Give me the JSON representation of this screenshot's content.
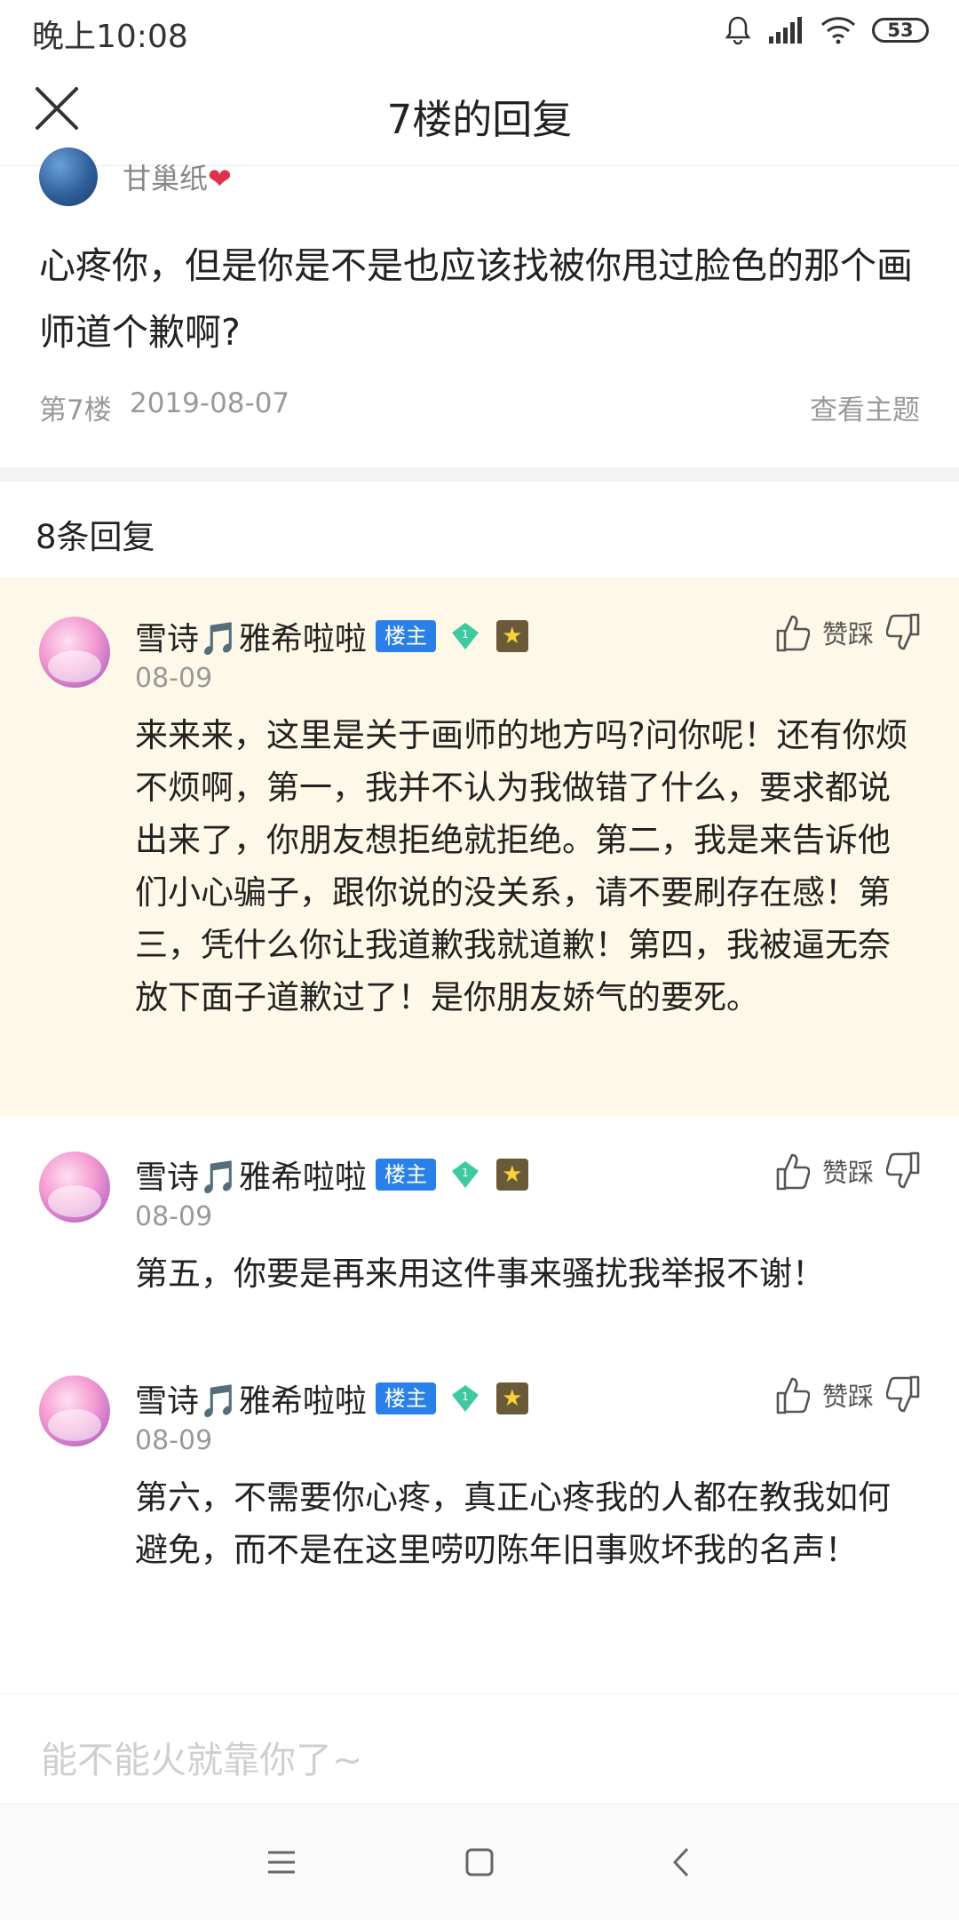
{
  "status_bar": {
    "time": "晚上10:08",
    "battery": "53"
  },
  "header": {
    "title": "7楼的回复"
  },
  "post": {
    "author": "甘巢纸",
    "body": "心疼你，但是你是不是也应该找被你甩过脸色的那个画师道个歉啊?",
    "floor": "第7楼",
    "date": "2019-08-07",
    "view_topic": "查看主题"
  },
  "reply_count_label": "8条回复",
  "replies": [
    {
      "name": "雪诗🎵雅希啦啦",
      "badge": "楼主",
      "level": "1",
      "date": "08-09",
      "like_label": "赞踩",
      "text": "来来来，这里是关于画师的地方吗?问你呢！还有你烦不烦啊，第一，我并不认为我做错了什么，要求都说出来了，你朋友想拒绝就拒绝。第二，我是来告诉他们小心骗子，跟你说的没关系，请不要刷存在感！第三，凭什么你让我道歉我就道歉！第四，我被逼无奈放下面子道歉过了！是你朋友娇气的要死。"
    },
    {
      "name": "雪诗🎵雅希啦啦",
      "badge": "楼主",
      "level": "1",
      "date": "08-09",
      "like_label": "赞踩",
      "text": "第五，你要是再来用这件事来骚扰我举报不谢！"
    },
    {
      "name": "雪诗🎵雅希啦啦",
      "badge": "楼主",
      "level": "1",
      "date": "08-09",
      "like_label": "赞踩",
      "text": "第六，不需要你心疼，真正心疼我的人都在教我如何避免，而不是在这里唠叨陈年旧事败坏我的名声！"
    }
  ],
  "input": {
    "placeholder": "能不能火就靠你了~"
  },
  "colors": {
    "accent": "#2b7fe8",
    "highlight_bg": "#fdf8e7",
    "gem": "#3ec9a0"
  }
}
